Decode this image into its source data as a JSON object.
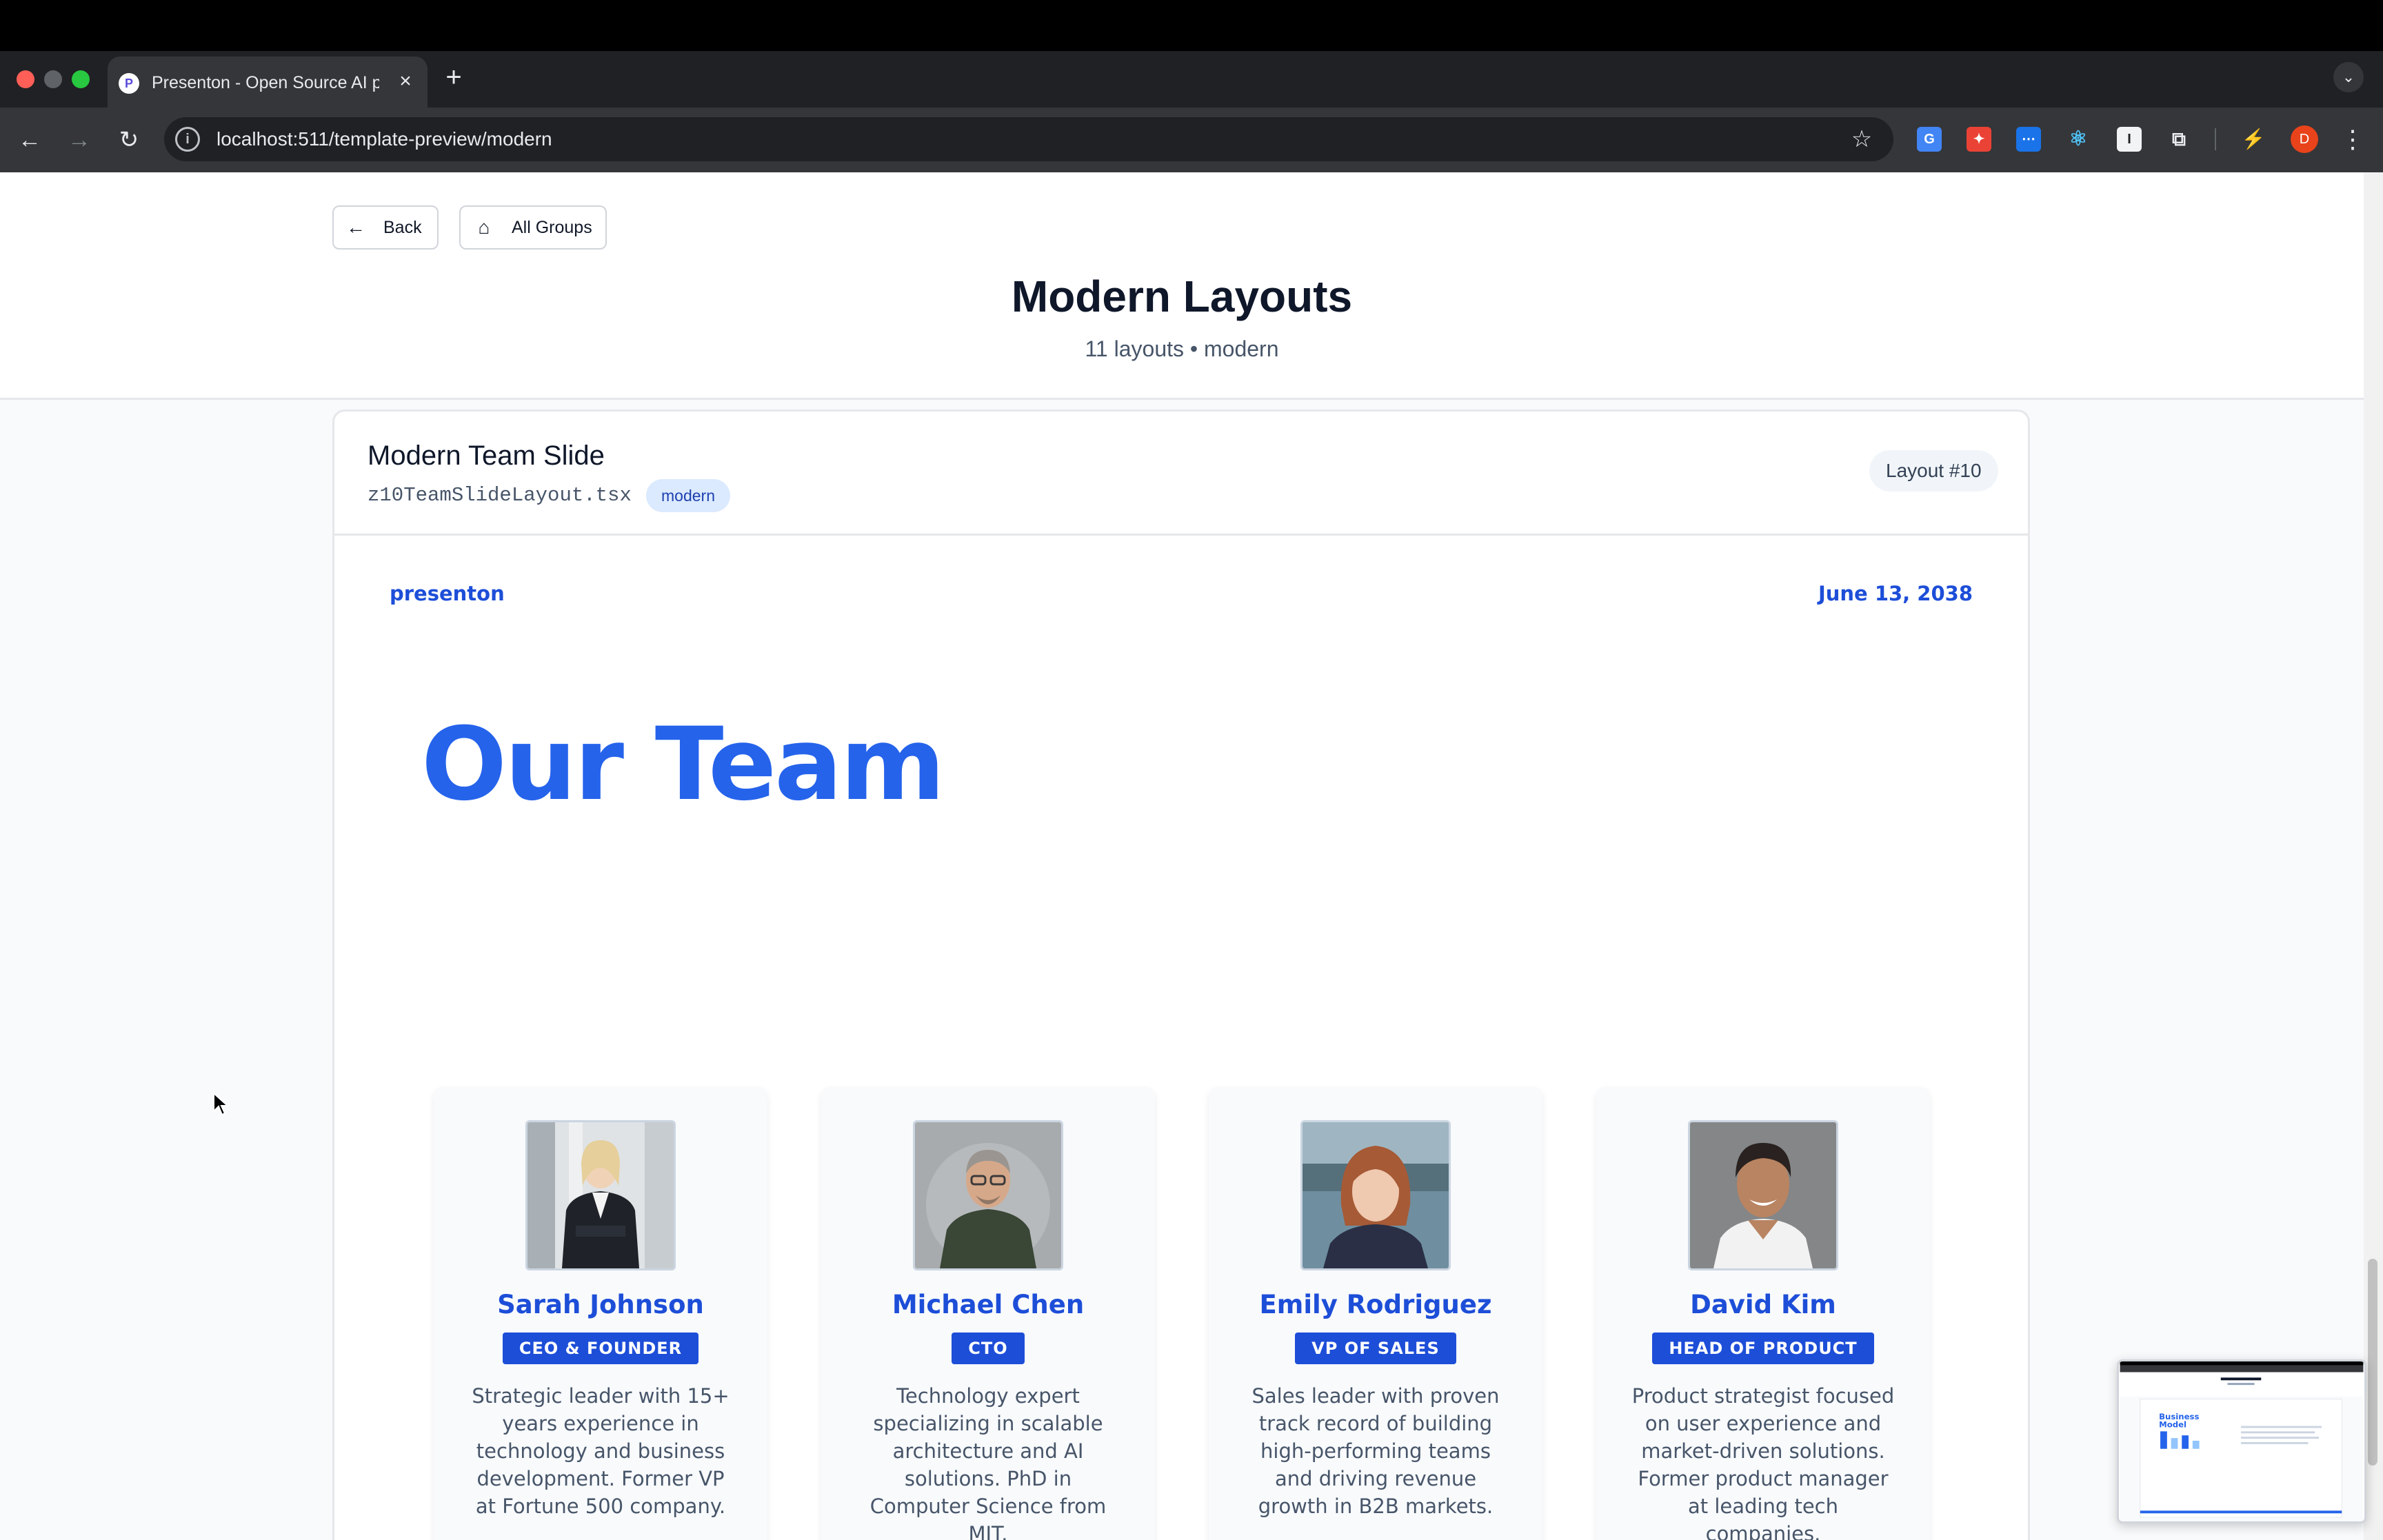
{
  "browser": {
    "tab_title": "Presenton - Open Source AI presentation generator",
    "tab_favicon": "P",
    "url": "localhost:511/template-preview/modern",
    "profile_initial": "D"
  },
  "header": {
    "back_label": "Back",
    "all_groups_label": "All Groups",
    "title": "Modern Layouts",
    "subtitle": "11 layouts • modern"
  },
  "layout_card": {
    "title": "Modern Team Slide",
    "file": "z10TeamSlideLayout.tsx",
    "tag": "modern",
    "badge": "Layout #10"
  },
  "slide": {
    "brand": "presenton",
    "date": "June 13, 2038",
    "title": "Our Team",
    "accent_color": "#2563eb",
    "members": [
      {
        "name": "Sarah Johnson",
        "role": "CEO & FOUNDER",
        "bio": "Strategic leader with 15+ years experience in technology and business development. Former VP at Fortune 500 company."
      },
      {
        "name": "Michael Chen",
        "role": "CTO",
        "bio": "Technology expert specializing in scalable architecture and AI solutions. PhD in Computer Science from MIT."
      },
      {
        "name": "Emily Rodriguez",
        "role": "VP OF SALES",
        "bio": "Sales leader with proven track record of building high-performing teams and driving revenue growth in B2B markets."
      },
      {
        "name": "David Kim",
        "role": "HEAD OF PRODUCT",
        "bio": "Product strategist focused on user experience and market-driven solutions. Former product manager at leading tech companies."
      }
    ]
  },
  "thumbnail": {
    "title": "Business Model",
    "header_title": "Modern Layouts"
  }
}
